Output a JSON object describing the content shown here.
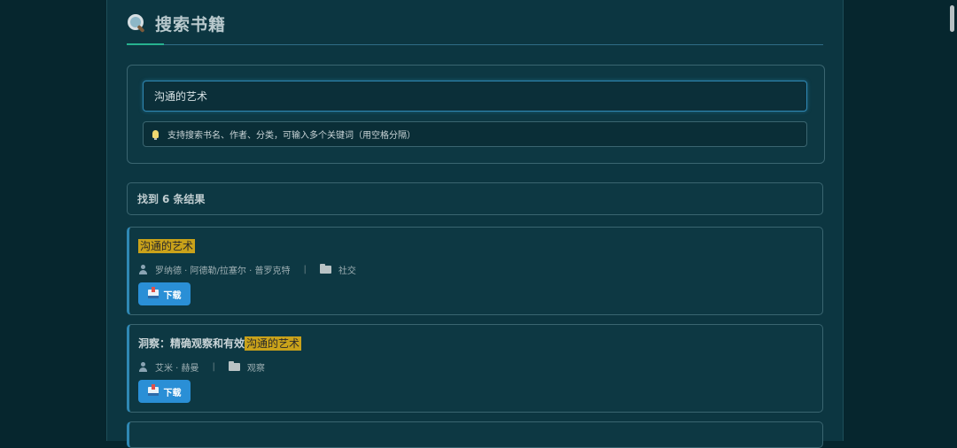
{
  "header": {
    "title": "搜索书籍",
    "icon": "magnifier-icon"
  },
  "search": {
    "value": "沟通的艺术",
    "hint": "支持搜索书名、作者、分类，可输入多个关键词（用空格分隔）"
  },
  "results": {
    "label_prefix": "找到",
    "count": "6",
    "label_suffix": "条结果",
    "items": [
      {
        "title_before": "",
        "title_highlight": "沟通的艺术",
        "author": "罗纳德 · 阿德勒/拉塞尔 · 普罗克特",
        "category": "社交",
        "download_label": "下载"
      },
      {
        "title_before": "洞察：精确观察和有效",
        "title_highlight": "沟通的艺术",
        "author": "艾米 · 赫曼",
        "category": "观察",
        "download_label": "下载"
      }
    ]
  },
  "colors": {
    "background": "#06262e",
    "panel": "#0c3641",
    "accent_blue": "#2a8fd6",
    "highlight": "#c9a21a",
    "header_accent": "#27b28f"
  }
}
